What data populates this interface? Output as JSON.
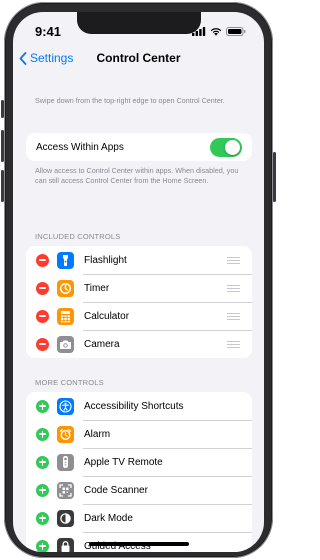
{
  "status_bar": {
    "time": "9:41"
  },
  "nav": {
    "back_label": "Settings",
    "title": "Control Center"
  },
  "intro_text": "Swipe down from the top-right edge to open Control Center.",
  "access_within_apps": {
    "label": "Access Within Apps",
    "enabled": true,
    "footer": "Allow access to Control Center within apps. When disabled, you can still access Control Center from the Home Screen."
  },
  "included_controls": {
    "header": "INCLUDED CONTROLS",
    "items": [
      {
        "label": "Flashlight",
        "icon": "flashlight-icon",
        "color": "#007aff"
      },
      {
        "label": "Timer",
        "icon": "timer-icon",
        "color": "#ff9500"
      },
      {
        "label": "Calculator",
        "icon": "calculator-icon",
        "color": "#ff9500"
      },
      {
        "label": "Camera",
        "icon": "camera-icon",
        "color": "#8e8e93"
      }
    ]
  },
  "more_controls": {
    "header": "MORE CONTROLS",
    "items": [
      {
        "label": "Accessibility Shortcuts",
        "icon": "accessibility-icon",
        "color": "#007aff"
      },
      {
        "label": "Alarm",
        "icon": "alarm-icon",
        "color": "#ff9500"
      },
      {
        "label": "Apple TV Remote",
        "icon": "remote-icon",
        "color": "#8e8e93"
      },
      {
        "label": "Code Scanner",
        "icon": "qr-scanner-icon",
        "color": "#8e8e93"
      },
      {
        "label": "Dark Mode",
        "icon": "dark-mode-icon",
        "color": "#3a3a3c"
      },
      {
        "label": "Guided Access",
        "icon": "guided-access-icon",
        "color": "#3a3a3c"
      }
    ]
  },
  "colors": {
    "accent": "#007aff",
    "toggle_on": "#34c759",
    "remove": "#ff3b30",
    "add": "#34c759",
    "background": "#f2f2f7"
  }
}
